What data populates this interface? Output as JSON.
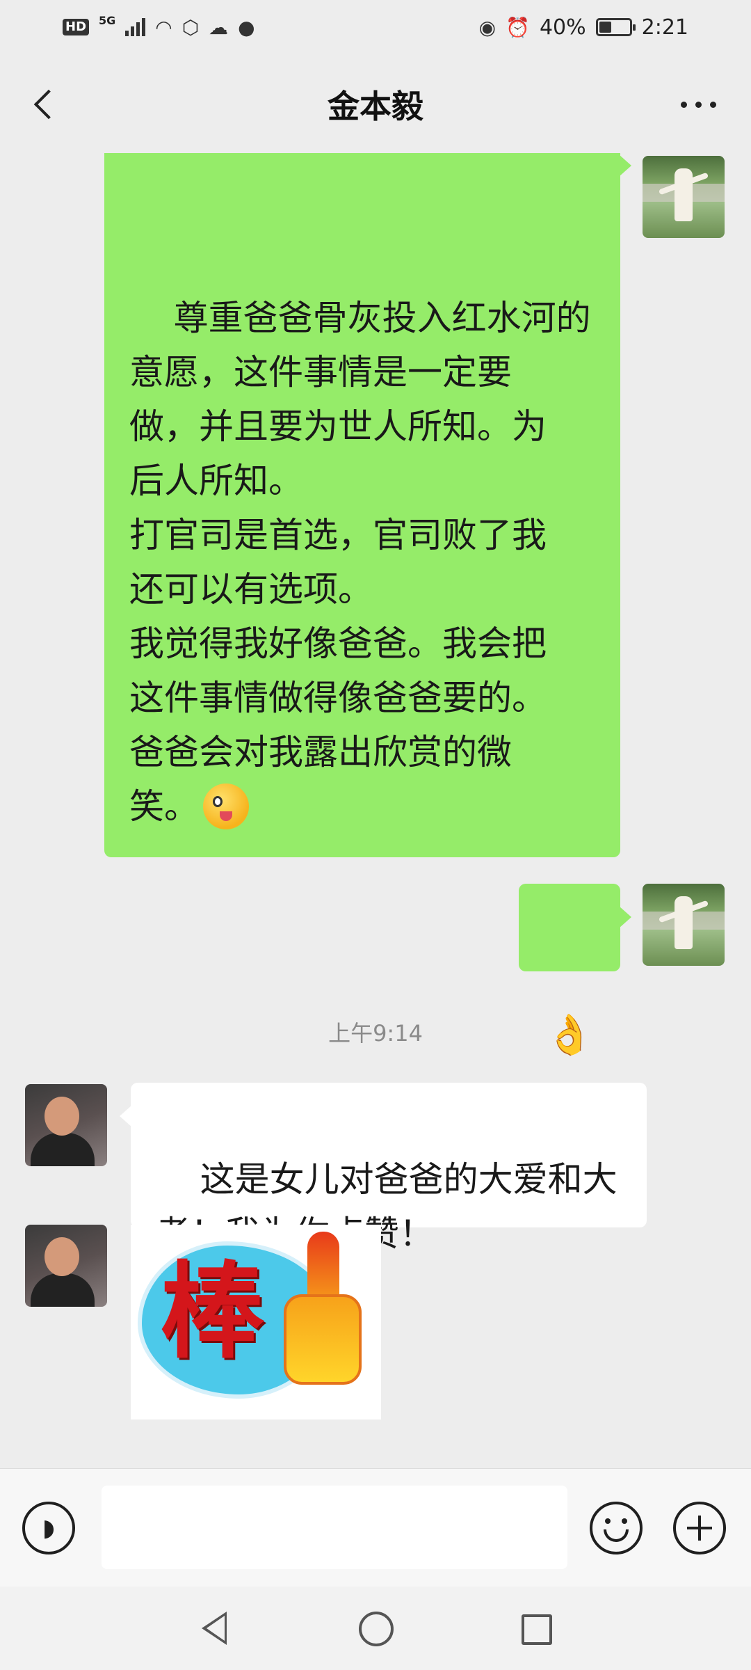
{
  "status_bar": {
    "network_badge": "HD",
    "network_type": "5G",
    "battery": "40%",
    "battery_level": 0.4,
    "time": "2:21",
    "icons": [
      "hd-icon",
      "signal-icon",
      "wifi-icon",
      "app-icon",
      "cloud-icon",
      "message-icon",
      "eye-icon",
      "alarm-icon",
      "battery-icon"
    ]
  },
  "header": {
    "title": "金本毅",
    "back_icon": "chevron-left-icon",
    "more_icon": "more-dots-icon"
  },
  "messages": [
    {
      "sender": "self",
      "type": "text",
      "text": "尊重爸爸骨灰投入红水河的\n意愿，这件事情是一定要\n做，并且要为世人所知。为\n后人所知。\n打官司是首选，官司败了我\n还可以有选项。\n我觉得我好像爸爸。我会把\n这件事情做得像爸爸要的。\n爸爸会对我露出欣赏的微\n笑。",
      "emoji": "wink-tongue-emoji"
    },
    {
      "sender": "self",
      "type": "emoji",
      "emoji": "👌"
    },
    {
      "type": "timestamp",
      "text": "上午9:14"
    },
    {
      "sender": "other",
      "type": "text",
      "text": "这是女儿对爸爸的大爱和大\n孝！我为你点赞！"
    },
    {
      "sender": "other",
      "type": "sticker",
      "sticker_text": "棒",
      "sticker_icon": "thumbs-up-icon"
    }
  ],
  "input_bar": {
    "voice_icon": "voice-icon",
    "emoji_icon": "emoji-icon",
    "plus_icon": "plus-icon",
    "text_value": ""
  },
  "nav_bar": {
    "icons": [
      "nav-back-icon",
      "nav-home-icon",
      "nav-recents-icon"
    ]
  },
  "colors": {
    "self_bubble": "#95ec69",
    "other_bubble": "#ffffff",
    "background": "#ededed"
  }
}
